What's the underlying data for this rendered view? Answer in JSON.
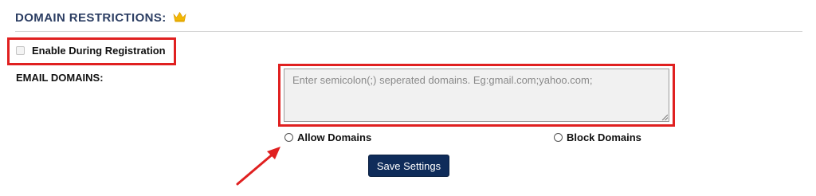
{
  "section": {
    "title": "DOMAIN RESTRICTIONS:",
    "premium_icon": "crown-icon",
    "premium_icon_color": "#f2b705"
  },
  "enable_registration": {
    "label": "Enable During Registration",
    "checked": false
  },
  "email_domains": {
    "label": "EMAIL DOMAINS:",
    "placeholder": "Enter semicolon(;) seperated domains. Eg:gmail.com;yahoo.com;",
    "value": ""
  },
  "domain_mode": {
    "options": [
      {
        "label": "Allow Domains",
        "selected": false
      },
      {
        "label": "Block Domains",
        "selected": false
      }
    ]
  },
  "actions": {
    "save_label": "Save Settings"
  },
  "annotation": {
    "highlight_color": "#e02020",
    "arrow_icon": "arrow-icon"
  },
  "colors": {
    "title": "#2c3e63",
    "button_bg": "#0f2c5a"
  }
}
